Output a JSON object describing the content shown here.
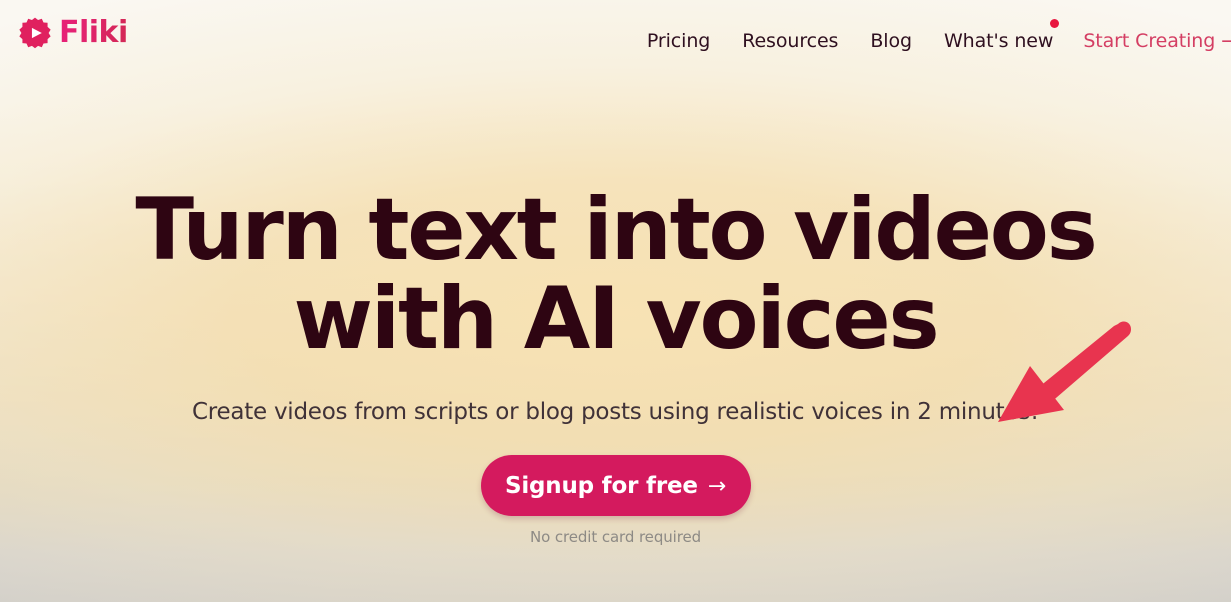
{
  "brand": {
    "name": "Fliki",
    "logo_icon": "fliki-gear-play-icon",
    "primary_color": "#d41a5e",
    "accent_color": "#e81f79"
  },
  "nav": {
    "items": [
      {
        "label": "Pricing",
        "name": "nav-item-pricing",
        "badge": false
      },
      {
        "label": "Resources",
        "name": "nav-item-resources",
        "badge": false
      },
      {
        "label": "Blog",
        "name": "nav-item-blog",
        "badge": false
      },
      {
        "label": "What's new",
        "name": "nav-item-whats-new",
        "badge": true
      }
    ],
    "cta": {
      "label": "Start Creating",
      "arrow": "→",
      "color": "#d43e63"
    },
    "badge_color": "#e8173f"
  },
  "hero": {
    "headline_line1": "Turn text into videos",
    "headline_line2": "with AI voices",
    "headline_color": "#2e0512",
    "subheadline": "Create videos from scripts or blog posts using realistic voices in 2 minutes!",
    "cta": {
      "label": "Signup for free",
      "arrow": "→",
      "background": "#d41a5e",
      "text_color": "#ffffff"
    },
    "note": "No credit card required",
    "note_color": "#8d8a85"
  },
  "annotation": {
    "type": "arrow",
    "direction": "down-left",
    "color": "#e8344f"
  },
  "background": {
    "top_color": "#faf8f3",
    "glow_color": "#f8e2b2",
    "bottom_color": "#d0cdc7"
  }
}
